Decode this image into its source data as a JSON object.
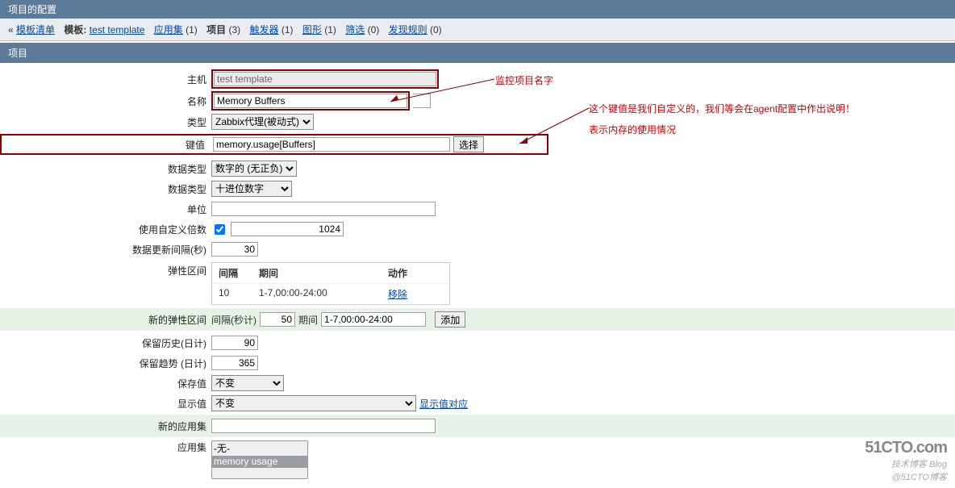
{
  "header": {
    "title": "项目的配置"
  },
  "nav": {
    "back_symbol": "«",
    "back_label": "模板清单",
    "template_label": "模板:",
    "template_name": "test template",
    "app_label": "应用集",
    "app_count": "(1)",
    "item_label": "项目",
    "item_count": "(3)",
    "trigger_label": "触发器",
    "trigger_count": "(1)",
    "graph_label": "图形",
    "graph_count": "(1)",
    "screen_label": "筛选",
    "screen_count": "(0)",
    "disc_label": "发现规则",
    "disc_count": "(0)"
  },
  "section": {
    "title": "项目"
  },
  "annotations": {
    "a1": "监控项目名字",
    "a2": "这个键值是我们自定义的，我们等会在agent配置中作出说明！",
    "a3": "表示内存的使用情况"
  },
  "form": {
    "host_label": "主机",
    "host_value": "test template",
    "name_label": "名称",
    "name_value": "Memory Buffers",
    "type_label": "类型",
    "type_value": "Zabbix代理(被动式)",
    "key_label": "键值",
    "key_value": "memory.usage[Buffers]",
    "key_btn": "选择",
    "datatype_label": "数据类型",
    "datatype_value": "数字的 (无正负)",
    "datafmt_label": "数据类型",
    "datafmt_value": "十进位数字",
    "unit_label": "单位",
    "unit_value": "",
    "mult_label": "使用自定义倍数",
    "mult_checked": true,
    "mult_value": "1024",
    "interval_label": "数据更新间隔(秒)",
    "interval_value": "30",
    "flex_label": "弹性区间",
    "flex_table": {
      "h1": "间隔",
      "h2": "期间",
      "h3": "动作",
      "r1c1": "10",
      "r1c2": "1-7,00:00-24:00",
      "r1c3": "移除"
    },
    "newflex_label": "新的弹性区间",
    "newflex_int_label": "间隔(秒计)",
    "newflex_int_value": "50",
    "newflex_period_label": "期间",
    "newflex_period_value": "1-7,00:00-24:00",
    "newflex_btn": "添加",
    "hist_label": "保留历史(日计)",
    "hist_value": "90",
    "trend_label": "保留趋势 (日计)",
    "trend_value": "365",
    "store_label": "保存值",
    "store_value": "不变",
    "show_label": "显示值",
    "show_value": "不变",
    "show_link": "显示值对应",
    "newapp_label": "新的应用集",
    "newapp_value": "",
    "app_label": "应用集",
    "app_none": "-无-",
    "app_mem": "memory usage"
  },
  "watermark": {
    "big": "51CTO.com",
    "sub1": "技术博客   Blog",
    "sub2": "@51CTO博客"
  }
}
